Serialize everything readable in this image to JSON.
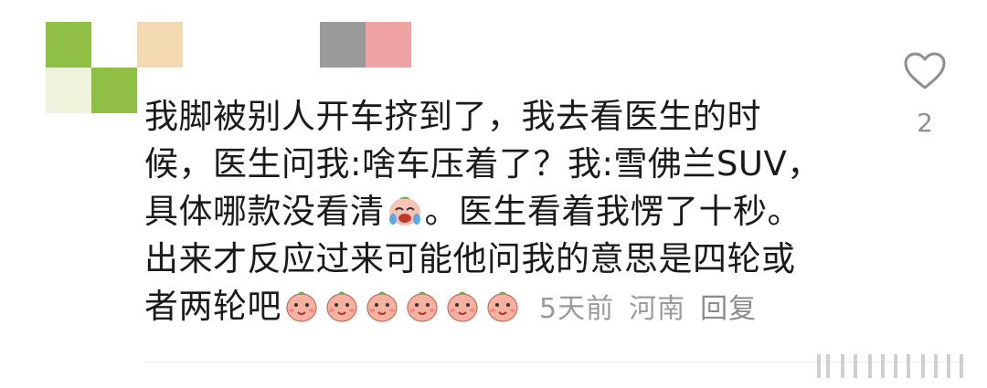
{
  "comment": {
    "lines": [
      "我脚被别人开车挤到了，我去看医生的时",
      "候，医生问我:啥车压着了？我:雪佛兰SUV，",
      "具体哪款没看清",
      "。医生看着我愣了十秒。",
      "出来才反应过来可能他问我的意思是四轮或",
      "者两轮吧"
    ],
    "inline_emoji": "laughing-crying-icon",
    "trailing_emoji_count": 6,
    "trailing_emoji": "peach-face-icon"
  },
  "meta": {
    "time": "5天前",
    "location": "河南",
    "reply_label": "回复"
  },
  "like": {
    "icon": "heart-outline-icon",
    "count": "2"
  },
  "colors": {
    "text": "#1a1a1a",
    "meta": "#9b9b9b",
    "avatar_green": "#8fbf45",
    "avatar_light": "#eef3dc"
  }
}
